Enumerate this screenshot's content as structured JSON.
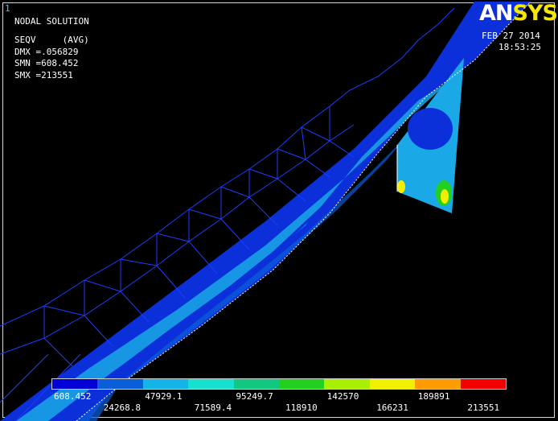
{
  "window_number": "1",
  "header": {
    "title": "NODAL SOLUTION",
    "result": "SEQV     (AVG)",
    "dmx": "DMX =.056829",
    "smn": "SMN =608.452",
    "smx": "SMX =213551"
  },
  "logo": {
    "part1": "AN",
    "part2": "SYS"
  },
  "timestamp": {
    "date": "FEB 27 2014",
    "time": "18:53:25"
  },
  "legend": {
    "colors": [
      "#0000d4",
      "#0a5ed8",
      "#14b4e8",
      "#18e0d0",
      "#12c880",
      "#22d020",
      "#a8f000",
      "#f0f000",
      "#ff9a00",
      "#f00000"
    ],
    "labels_top": [
      "608.452",
      "47929.1",
      "95249.7",
      "142570",
      "189891"
    ],
    "labels_bottom": [
      "24268.8",
      "71589.4",
      "118910",
      "166231",
      "213551"
    ]
  }
}
